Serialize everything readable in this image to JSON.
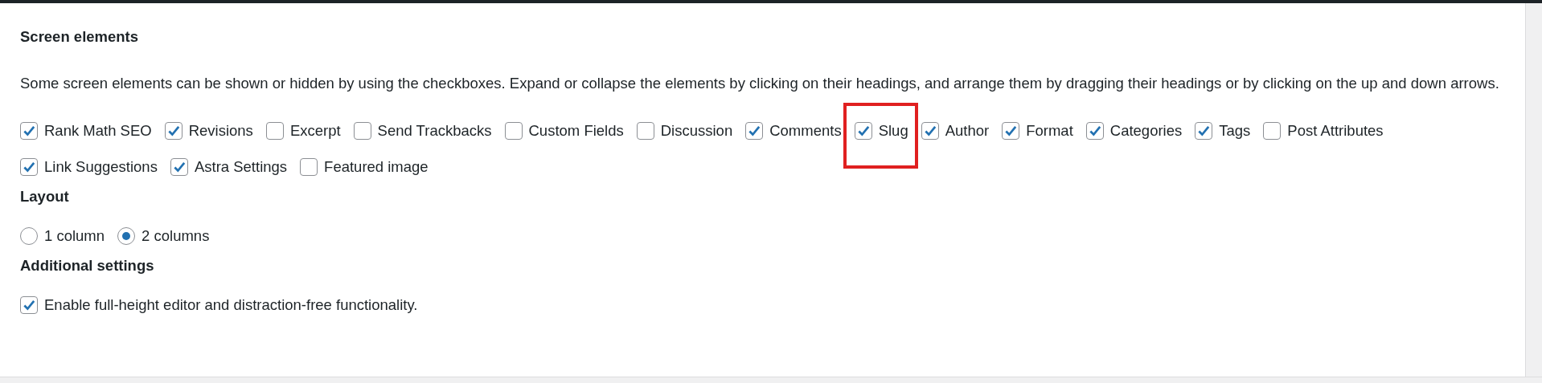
{
  "screen_elements": {
    "heading": "Screen elements",
    "description": "Some screen elements can be shown or hidden by using the checkboxes. Expand or collapse the elements by clicking on their headings, and arrange them by dragging their headings or by clicking on the up and down arrows.",
    "items": [
      {
        "label": "Rank Math SEO",
        "checked": true,
        "highlighted": false
      },
      {
        "label": "Revisions",
        "checked": true,
        "highlighted": false
      },
      {
        "label": "Excerpt",
        "checked": false,
        "highlighted": false
      },
      {
        "label": "Send Trackbacks",
        "checked": false,
        "highlighted": false
      },
      {
        "label": "Custom Fields",
        "checked": false,
        "highlighted": false
      },
      {
        "label": "Discussion",
        "checked": false,
        "highlighted": false
      },
      {
        "label": "Comments",
        "checked": true,
        "highlighted": false
      },
      {
        "label": "Slug",
        "checked": true,
        "highlighted": true
      },
      {
        "label": "Author",
        "checked": true,
        "highlighted": false
      },
      {
        "label": "Format",
        "checked": true,
        "highlighted": false
      },
      {
        "label": "Categories",
        "checked": true,
        "highlighted": false
      },
      {
        "label": "Tags",
        "checked": true,
        "highlighted": false
      },
      {
        "label": "Post Attributes",
        "checked": false,
        "highlighted": false
      },
      {
        "label": "Link Suggestions",
        "checked": true,
        "highlighted": false
      },
      {
        "label": "Astra Settings",
        "checked": true,
        "highlighted": false
      },
      {
        "label": "Featured image",
        "checked": false,
        "highlighted": false
      }
    ]
  },
  "layout": {
    "heading": "Layout",
    "options": [
      {
        "label": "1 column",
        "selected": false
      },
      {
        "label": "2 columns",
        "selected": true
      }
    ]
  },
  "additional_settings": {
    "heading": "Additional settings",
    "items": [
      {
        "label": "Enable full-height editor and distraction-free functionality.",
        "checked": true
      }
    ]
  }
}
